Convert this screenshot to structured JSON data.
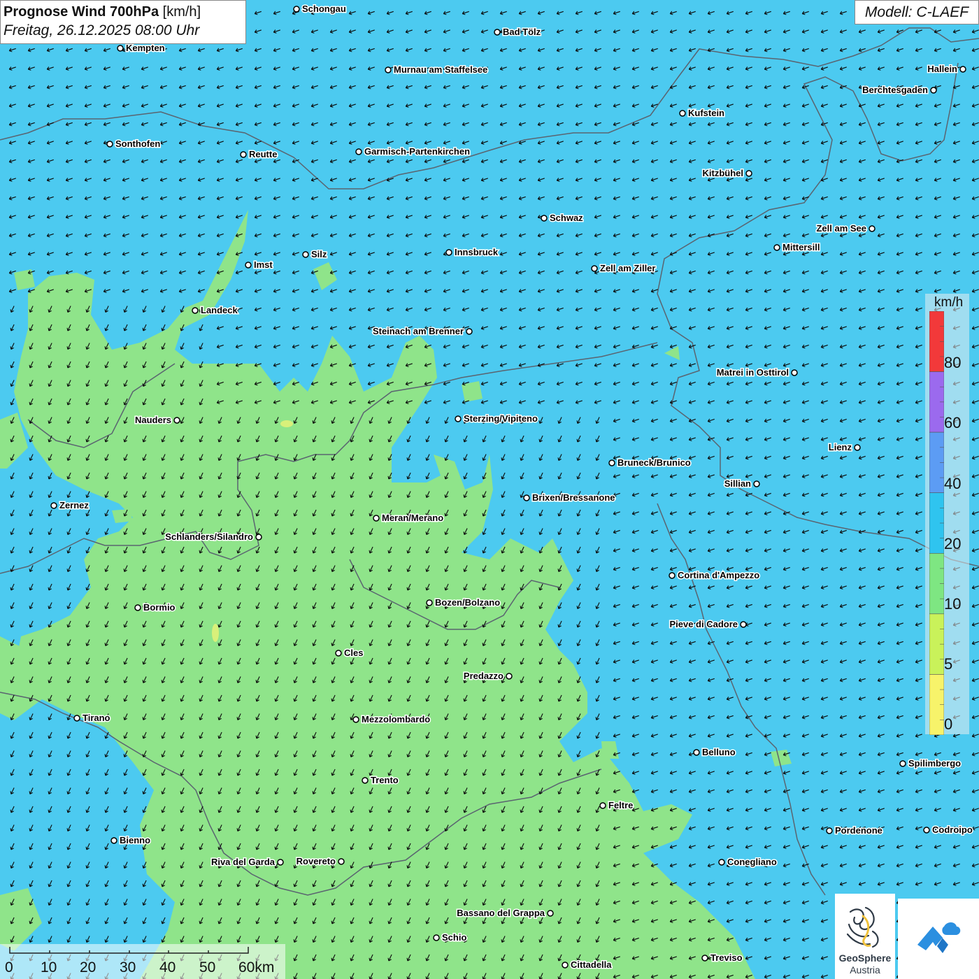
{
  "header": {
    "title_bold": "Prognose Wind 700hPa",
    "title_unit": "[km/h]",
    "subtitle": "Freitag, 26.12.2025 08:00 Uhr",
    "model": "Modell: C-LAEF"
  },
  "legend": {
    "unit": "km/h",
    "labels": [
      "80",
      "60",
      "40",
      "20",
      "10",
      "5",
      "0"
    ],
    "colors": [
      "#f2393a",
      "#9b6aee",
      "#5c9cf4",
      "#2fc4ef",
      "#7ee682",
      "#c9f25a",
      "#f7f36a"
    ]
  },
  "scalebar": {
    "labels": [
      "0",
      "10",
      "20",
      "30",
      "40",
      "50",
      "60km"
    ]
  },
  "colors": {
    "sea_of_calm_blue": "#4ccaf0",
    "green_zone": "#8fe48a",
    "border": "#5a6470",
    "arrow": "#0b0b0b"
  },
  "cities": [
    {
      "name": "Schongau"
    },
    {
      "name": "Bad Tölz"
    },
    {
      "name": "Kempten"
    },
    {
      "name": "Murnau am Staffelsee"
    },
    {
      "name": "Hallein"
    },
    {
      "name": "Berchtesgaden"
    },
    {
      "name": "Kufstein"
    },
    {
      "name": "Sonthofen"
    },
    {
      "name": "Reutte"
    },
    {
      "name": "Garmisch-Partenkirchen"
    },
    {
      "name": "Kitzbühel"
    },
    {
      "name": "Schwaz"
    },
    {
      "name": "Zell am See"
    },
    {
      "name": "Mittersill"
    },
    {
      "name": "Innsbruck"
    },
    {
      "name": "Silz"
    },
    {
      "name": "Imst"
    },
    {
      "name": "Zell am Ziller"
    },
    {
      "name": "Landeck"
    },
    {
      "name": "Steinach am Brenner"
    },
    {
      "name": "Matrei in Osttirol"
    },
    {
      "name": "Nauders"
    },
    {
      "name": "Sterzing/Vipiteno"
    },
    {
      "name": "Lienz"
    },
    {
      "name": "Bruneck/Brunico"
    },
    {
      "name": "Sillian"
    },
    {
      "name": "Brixen/Bressanone"
    },
    {
      "name": "Zernez"
    },
    {
      "name": "Meran/Merano"
    },
    {
      "name": "Schlanders/Silandro"
    },
    {
      "name": "Cortina d'Ampezzo"
    },
    {
      "name": "Bozen/Bolzano"
    },
    {
      "name": "Bormio"
    },
    {
      "name": "Pieve di Cadore"
    },
    {
      "name": "Cles"
    },
    {
      "name": "Predazzo"
    },
    {
      "name": "Tirano"
    },
    {
      "name": "Mezzolombardo"
    },
    {
      "name": "Belluno"
    },
    {
      "name": "Spilimbergo"
    },
    {
      "name": "Trento"
    },
    {
      "name": "Feltre"
    },
    {
      "name": "Pordenone"
    },
    {
      "name": "Codroipo"
    },
    {
      "name": "Bienno"
    },
    {
      "name": "Riva del Garda"
    },
    {
      "name": "Rovereto"
    },
    {
      "name": "Conegliano"
    },
    {
      "name": "Bassano del Grappa"
    },
    {
      "name": "Schio"
    },
    {
      "name": "Treviso"
    },
    {
      "name": "Cittadella"
    }
  ],
  "logo": {
    "name": "GeoSphere",
    "country": "Austria"
  }
}
